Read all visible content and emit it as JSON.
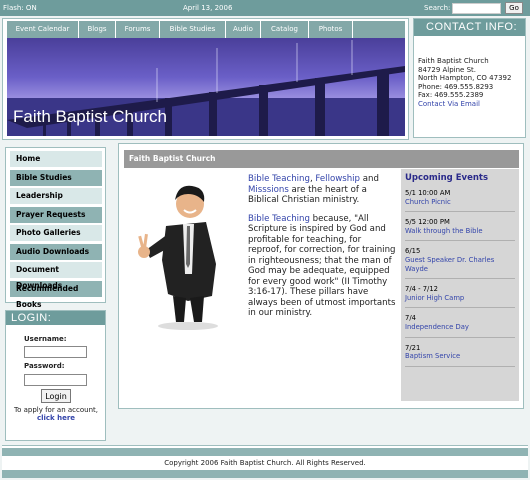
{
  "topbar": {
    "flash": "Flash: ON",
    "date": "April 13, 2006",
    "search_label": "Search:",
    "search_value": "",
    "go_label": "Go"
  },
  "nav": [
    "Event Calendar",
    "Blogs",
    "Forums",
    "Bible Studies",
    "Audio",
    "Catalog",
    "Photos"
  ],
  "banner": {
    "church_name": "Faith Baptist Church"
  },
  "contact": {
    "title": "CONTACT INFO:",
    "name": "Faith Baptist Church",
    "street": "84729 Alpine St.",
    "city": "North Hampton, CO  47392",
    "phone": "Phone: 469.555.8293",
    "fax": "Fax: 469.555.2389",
    "email_link": "Contact Via Email"
  },
  "sidebar": {
    "items": [
      {
        "label": "Home",
        "tone": "light"
      },
      {
        "label": "Bible Studies",
        "tone": "dark"
      },
      {
        "label": "Leadership",
        "tone": "light"
      },
      {
        "label": "Prayer Requests",
        "tone": "dark"
      },
      {
        "label": "Photo Galleries",
        "tone": "light"
      },
      {
        "label": "Audio Downloads",
        "tone": "dark"
      },
      {
        "label": "Document Downloads",
        "tone": "light"
      },
      {
        "label": "Recommended Books",
        "tone": "dark"
      }
    ]
  },
  "login": {
    "title": "LOGIN:",
    "username_label": "Username:",
    "password_label": "Password:",
    "button_label": "Login",
    "note_text": "To apply for an account,",
    "note_link": "click here"
  },
  "content": {
    "header": "Faith Baptist Church",
    "para1": {
      "link1": "Bible Teaching",
      "sep": ", ",
      "link2": "Fellowship",
      "and": " and ",
      "link3": "Misssions",
      "rest": " are the heart of a Biblical Christian ministry."
    },
    "para2": {
      "link": "Bible Teaching",
      "rest": "  because, \"All Scripture is inspired by God and profitable for teaching, for reproof, for correction, for training in righteousness; that the man of God may be adequate, equipped for every good work\" (II Timothy 3:16-17).  These pillars have always been of utmost importants in our ministry."
    }
  },
  "events": {
    "title": "Upcoming Events",
    "items": [
      {
        "when": "5/1 10:00 AM",
        "what": "Church Picnic"
      },
      {
        "when": "5/5 12:00 PM",
        "what": "Walk through the Bible"
      },
      {
        "when": "6/15",
        "what": "Guest Speaker Dr. Charles Wayde"
      },
      {
        "when": "7/4 - 7/12",
        "what": "Junior High Camp"
      },
      {
        "when": "7/4",
        "what": "Independence Day"
      },
      {
        "when": "7/21",
        "what": "Baptism Service"
      }
    ]
  },
  "footer": {
    "copyright": "Copyright 2006 Faith Baptist Church. All Rights Reserved."
  }
}
